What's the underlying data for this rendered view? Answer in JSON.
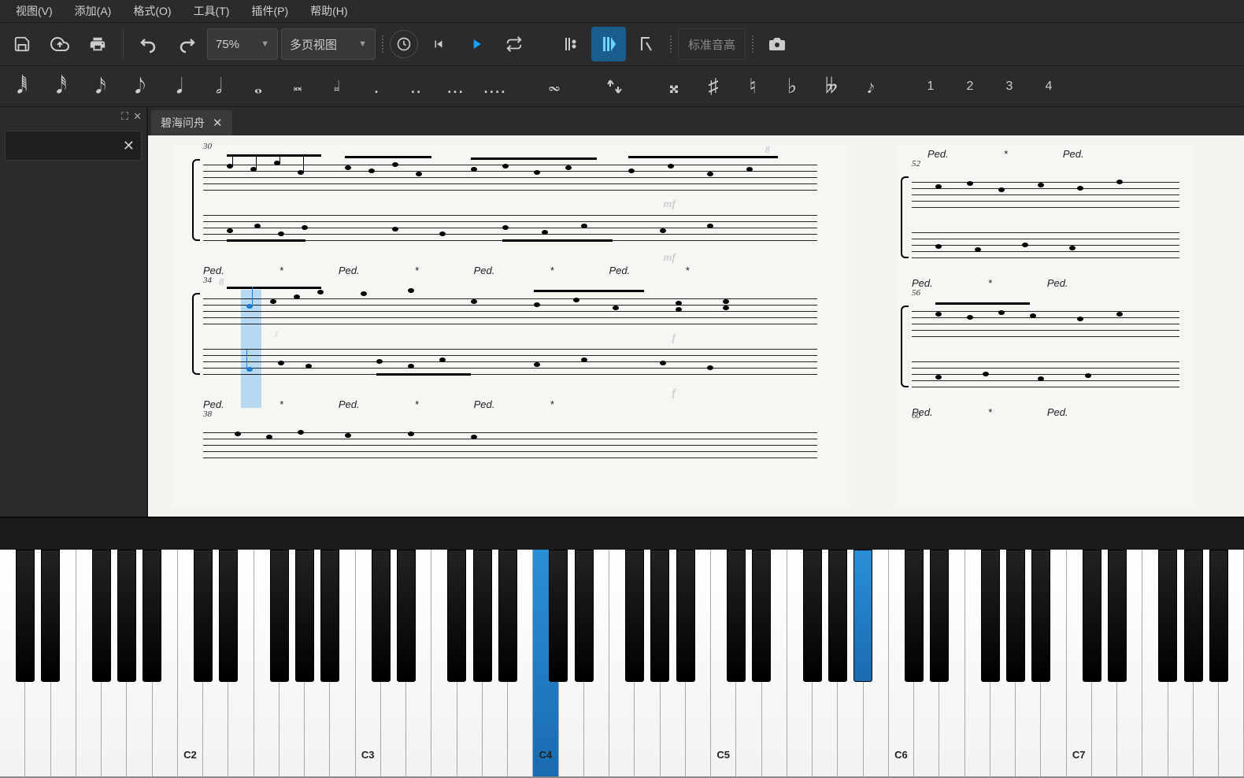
{
  "menu": {
    "items": [
      "视图(V)",
      "添加(A)",
      "格式(O)",
      "工具(T)",
      "插件(P)",
      "帮助(H)"
    ]
  },
  "toolbar": {
    "zoom": "75%",
    "view_mode": "多页视图",
    "concert_pitch": "标准音高"
  },
  "voices": [
    "1",
    "2",
    "3",
    "4"
  ],
  "tab": {
    "title": "碧海问舟"
  },
  "score": {
    "measure_numbers_p1": [
      "30",
      "34",
      "38"
    ],
    "measure_numbers_p2": [
      "52",
      "56",
      "60"
    ],
    "dynamics": [
      "mf",
      "mf",
      "f",
      "f"
    ],
    "ottava": "8",
    "pedal_mark": "Ped.",
    "tuplet": "3"
  },
  "piano": {
    "octave_labels": [
      "C2",
      "C3",
      "C4",
      "C5",
      "C6",
      "C7"
    ],
    "pressed_white_index": 21,
    "pressed_black_after_white": 33
  }
}
